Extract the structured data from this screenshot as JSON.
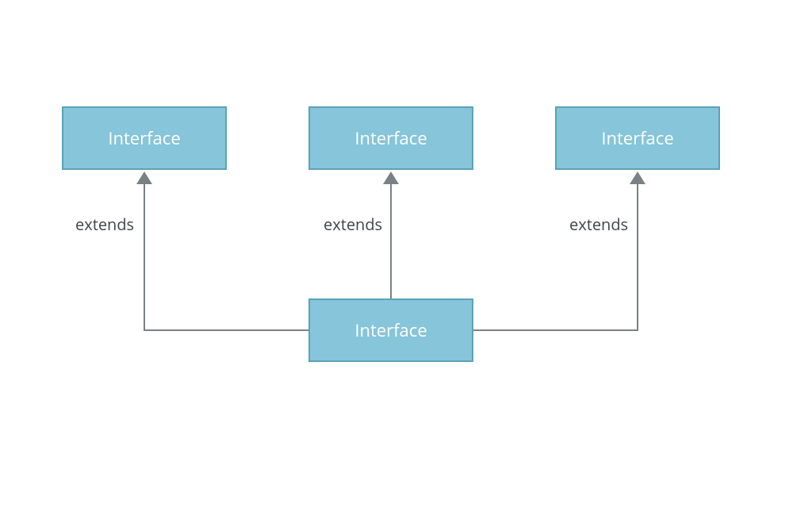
{
  "nodes": {
    "top_left": {
      "label": "Interface"
    },
    "top_mid": {
      "label": "Interface"
    },
    "top_right": {
      "label": "Interface"
    },
    "bottom": {
      "label": "Interface"
    }
  },
  "edges": {
    "left": {
      "label": "extends"
    },
    "mid": {
      "label": "extends"
    },
    "right": {
      "label": "extends"
    }
  },
  "colors": {
    "box_fill": "#86c5da",
    "box_border": "#5aa3b8",
    "box_text": "#ffffff",
    "edge": "#7a8184",
    "label": "#3f4547"
  }
}
